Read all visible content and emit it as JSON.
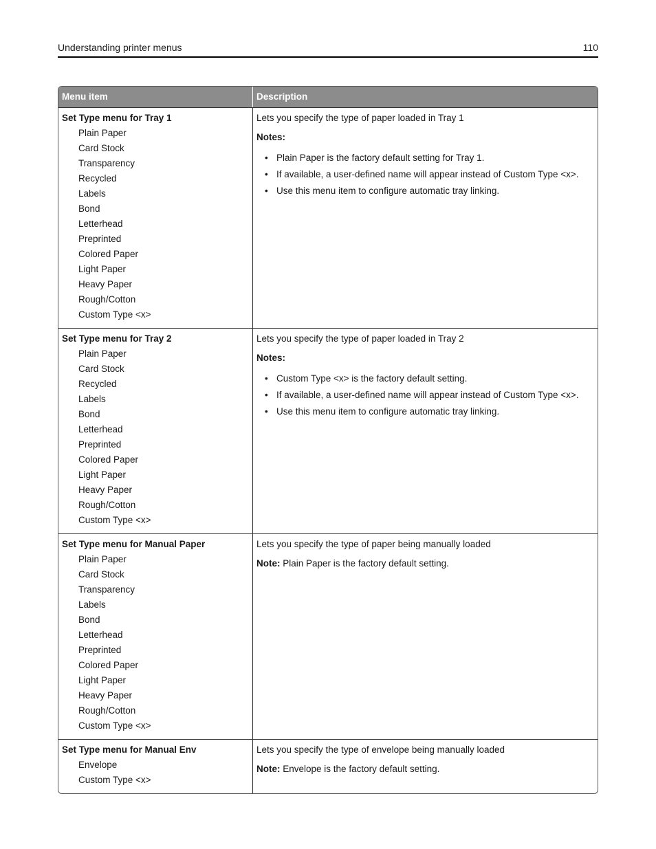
{
  "header": {
    "title": "Understanding printer menus",
    "page_number": "110"
  },
  "table": {
    "columns": [
      "Menu item",
      "Description"
    ],
    "rows": [
      {
        "title": "Set Type menu for Tray 1",
        "options": [
          "Plain Paper",
          "Card Stock",
          "Transparency",
          "Recycled",
          "Labels",
          "Bond",
          "Letterhead",
          "Preprinted",
          "Colored Paper",
          "Light Paper",
          "Heavy Paper",
          "Rough/Cotton",
          "Custom Type <x>"
        ],
        "description": "Lets you specify the type of paper loaded in Tray 1",
        "notes_heading": "Notes:",
        "notes": [
          "Plain Paper is the factory default setting for Tray 1.",
          "If available, a user-defined name will appear instead of Custom Type <x>.",
          "Use this menu item to configure automatic tray linking."
        ]
      },
      {
        "title": "Set Type menu for Tray 2",
        "options": [
          "Plain Paper",
          "Card Stock",
          "Recycled",
          "Labels",
          "Bond",
          "Letterhead",
          "Preprinted",
          "Colored Paper",
          "Light Paper",
          "Heavy Paper",
          "Rough/Cotton",
          "Custom Type <x>"
        ],
        "description": "Lets you specify the type of paper loaded in Tray 2",
        "notes_heading": "Notes:",
        "notes": [
          "Custom Type <x> is the factory default setting.",
          "If available, a user-defined name will appear instead of Custom Type <x>.",
          "Use this menu item to configure automatic tray linking."
        ]
      },
      {
        "title": "Set Type menu for Manual Paper",
        "options": [
          "Plain Paper",
          "Card Stock",
          "Transparency",
          "Labels",
          "Bond",
          "Letterhead",
          "Preprinted",
          "Colored Paper",
          "Light Paper",
          "Heavy Paper",
          "Rough/Cotton",
          "Custom Type <x>"
        ],
        "description": "Lets you specify the type of paper being manually loaded",
        "note_label": "Note:",
        "note_text": " Plain Paper is the factory default setting."
      },
      {
        "title": "Set Type menu for Manual Env",
        "options": [
          "Envelope",
          "Custom Type <x>"
        ],
        "description": "Lets you specify the type of envelope being manually loaded",
        "note_label": "Note:",
        "note_text": " Envelope is the factory default setting."
      }
    ]
  },
  "bullet_glyph": "•"
}
